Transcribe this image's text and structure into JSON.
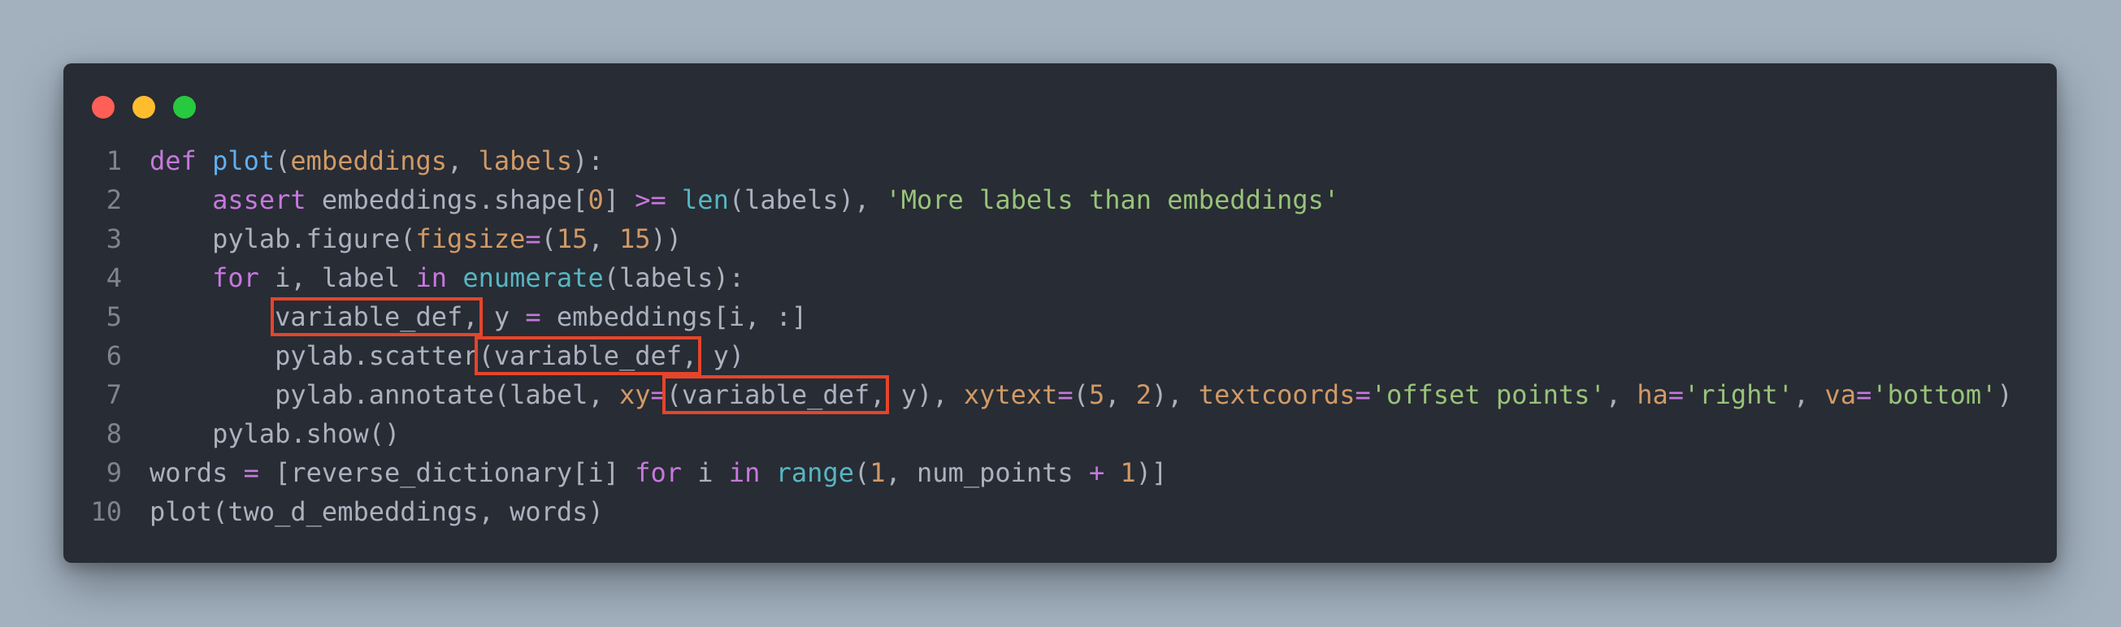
{
  "window": {
    "buttons": [
      "close",
      "minimize",
      "maximize"
    ]
  },
  "lines": [
    {
      "num": "1",
      "tokens": [
        {
          "t": "def",
          "c": "k"
        },
        {
          "t": " ",
          "c": "t"
        },
        {
          "t": "plot",
          "c": "f"
        },
        {
          "t": "(",
          "c": "t"
        },
        {
          "t": "embeddings",
          "c": "p"
        },
        {
          "t": ", ",
          "c": "t"
        },
        {
          "t": "labels",
          "c": "p"
        },
        {
          "t": "):",
          "c": "t"
        }
      ]
    },
    {
      "num": "2",
      "tokens": [
        {
          "t": "    ",
          "c": "t"
        },
        {
          "t": "assert",
          "c": "k"
        },
        {
          "t": " embeddings.shape[",
          "c": "t"
        },
        {
          "t": "0",
          "c": "n"
        },
        {
          "t": "] ",
          "c": "t"
        },
        {
          "t": ">=",
          "c": "o"
        },
        {
          "t": " ",
          "c": "t"
        },
        {
          "t": "len",
          "c": "b"
        },
        {
          "t": "(labels), ",
          "c": "t"
        },
        {
          "t": "'More labels than embeddings'",
          "c": "s"
        }
      ]
    },
    {
      "num": "3",
      "tokens": [
        {
          "t": "    pylab.figure(",
          "c": "t"
        },
        {
          "t": "figsize",
          "c": "p"
        },
        {
          "t": "=",
          "c": "o"
        },
        {
          "t": "(",
          "c": "t"
        },
        {
          "t": "15",
          "c": "n"
        },
        {
          "t": ", ",
          "c": "t"
        },
        {
          "t": "15",
          "c": "n"
        },
        {
          "t": "))",
          "c": "t"
        }
      ]
    },
    {
      "num": "4",
      "tokens": [
        {
          "t": "    ",
          "c": "t"
        },
        {
          "t": "for",
          "c": "k"
        },
        {
          "t": " i, label ",
          "c": "t"
        },
        {
          "t": "in",
          "c": "k"
        },
        {
          "t": " ",
          "c": "t"
        },
        {
          "t": "enumerate",
          "c": "b"
        },
        {
          "t": "(labels):",
          "c": "t"
        }
      ]
    },
    {
      "num": "5",
      "tokens": [
        {
          "t": "        ",
          "c": "t"
        },
        {
          "t": "variable_def,",
          "c": "t",
          "hl": true
        },
        {
          "t": " y ",
          "c": "t"
        },
        {
          "t": "=",
          "c": "o"
        },
        {
          "t": " embeddings[i, :]",
          "c": "t"
        }
      ]
    },
    {
      "num": "6",
      "tokens": [
        {
          "t": "        pylab.scatter",
          "c": "t"
        },
        {
          "t": "(variable_def,",
          "c": "t",
          "hl": true
        },
        {
          "t": " y)",
          "c": "t"
        }
      ]
    },
    {
      "num": "7",
      "tokens": [
        {
          "t": "        pylab.annotate(label, ",
          "c": "t"
        },
        {
          "t": "xy",
          "c": "p"
        },
        {
          "t": "=",
          "c": "o"
        },
        {
          "t": "(variable_def,",
          "c": "t",
          "hl": true
        },
        {
          "t": " y), ",
          "c": "t"
        },
        {
          "t": "xytext",
          "c": "p"
        },
        {
          "t": "=",
          "c": "o"
        },
        {
          "t": "(",
          "c": "t"
        },
        {
          "t": "5",
          "c": "n"
        },
        {
          "t": ", ",
          "c": "t"
        },
        {
          "t": "2",
          "c": "n"
        },
        {
          "t": "), ",
          "c": "t"
        },
        {
          "t": "textcoords",
          "c": "p"
        },
        {
          "t": "=",
          "c": "o"
        },
        {
          "t": "'offset points'",
          "c": "s"
        },
        {
          "t": ", ",
          "c": "t"
        },
        {
          "t": "ha",
          "c": "p"
        },
        {
          "t": "=",
          "c": "o"
        },
        {
          "t": "'right'",
          "c": "s"
        },
        {
          "t": ", ",
          "c": "t"
        },
        {
          "t": "va",
          "c": "p"
        },
        {
          "t": "=",
          "c": "o"
        },
        {
          "t": "'bottom'",
          "c": "s"
        },
        {
          "t": ")",
          "c": "t"
        }
      ]
    },
    {
      "num": "8",
      "tokens": [
        {
          "t": "    pylab.show()",
          "c": "t"
        }
      ]
    },
    {
      "num": "9",
      "tokens": [
        {
          "t": "words ",
          "c": "t"
        },
        {
          "t": "=",
          "c": "o"
        },
        {
          "t": " [reverse_dictionary[i] ",
          "c": "t"
        },
        {
          "t": "for",
          "c": "k"
        },
        {
          "t": " i ",
          "c": "t"
        },
        {
          "t": "in",
          "c": "k"
        },
        {
          "t": " ",
          "c": "t"
        },
        {
          "t": "range",
          "c": "b"
        },
        {
          "t": "(",
          "c": "t"
        },
        {
          "t": "1",
          "c": "n"
        },
        {
          "t": ", num_points ",
          "c": "t"
        },
        {
          "t": "+",
          "c": "o"
        },
        {
          "t": " ",
          "c": "t"
        },
        {
          "t": "1",
          "c": "n"
        },
        {
          "t": ")]",
          "c": "t"
        }
      ]
    },
    {
      "num": "10",
      "tokens": [
        {
          "t": "plot(two_d_embeddings, words)",
          "c": "t"
        }
      ]
    }
  ]
}
